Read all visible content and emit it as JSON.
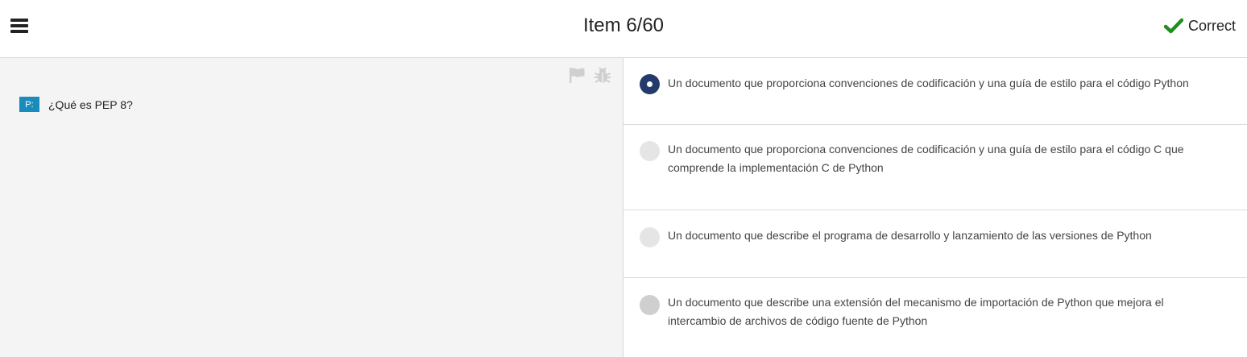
{
  "header": {
    "item_counter": "Item 6/60",
    "result_label": "Correct",
    "result_icon": "check-icon",
    "result_color": "#1e8e1e"
  },
  "question": {
    "badge": "P:",
    "text": "¿Qué es PEP 8?",
    "tools": [
      "flag-icon",
      "bug-icon"
    ]
  },
  "options": [
    {
      "text": "Un documento que proporciona convenciones de codificación y una guía de estilo para el código Python",
      "selected": true
    },
    {
      "text": "Un documento que proporciona convenciones de codificación y una guía de estilo para el código C que comprende la implementación C de Python",
      "selected": false
    },
    {
      "text": "Un documento que describe el programa de desarrollo y lanzamiento de las versiones de Python",
      "selected": false
    },
    {
      "text": "Un documento que describe una extensión del mecanismo de importación de Python que mejora el intercambio de archivos de código fuente de Python",
      "selected": false
    }
  ],
  "colors": {
    "selected_radio": "#233a6b",
    "badge": "#1a8cbc",
    "left_pane_bg": "#f4f4f4"
  }
}
